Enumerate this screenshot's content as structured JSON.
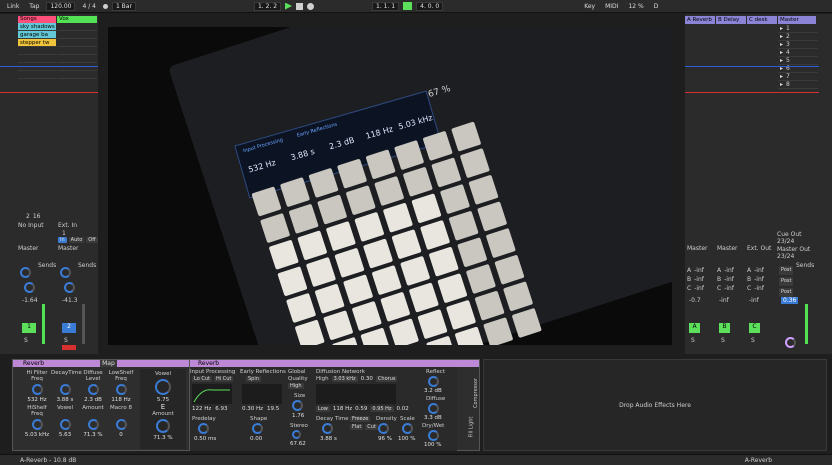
{
  "topbar": {
    "link": "Link",
    "tap": "Tap",
    "tempo": "120.00",
    "sig": "4 / 4",
    "metro": "1 Bar",
    "position": "1.  2.  2",
    "loop_start": "1.  1.  1",
    "loop_len": "4.  0.  0",
    "key": "Key",
    "midi": "MIDI",
    "cpu": "12 %",
    "disk": "D"
  },
  "tracks": {
    "headers": [
      "Songs",
      "Vox"
    ],
    "clips": [
      "sky shadows",
      "garage ba",
      "stepper tw"
    ],
    "input": {
      "none": "No Input",
      "ext": "Ext. In",
      "ch": "1"
    },
    "monitor": {
      "in": "In",
      "auto": "Auto",
      "off": "Off"
    },
    "routing": [
      "Master",
      "Master"
    ],
    "sends_label": "Sends",
    "volumes": [
      "-1.64",
      "-41.3"
    ],
    "numbers": [
      "1",
      "2"
    ],
    "solo": "S",
    "counts": [
      "2",
      "16"
    ]
  },
  "returns": {
    "headers": [
      "A Reverb",
      "B Delay",
      "C desk",
      "Master"
    ],
    "scenes": [
      "1",
      "2",
      "3",
      "4",
      "5",
      "6",
      "7",
      "8"
    ],
    "cue_out": "Cue Out",
    "cue_val": "23/24",
    "master_out": "Master Out",
    "master_val": "23/24",
    "routing": [
      "Master",
      "Master",
      "Ext. Out"
    ],
    "inf": "-inf",
    "post": "Post",
    "volumes": [
      "-0.7",
      "-inf",
      "-inf",
      "0.36"
    ],
    "letters": [
      "A",
      "B",
      "C"
    ],
    "solo": "S"
  },
  "video_text": {
    "screen": [
      "Input Processing",
      "Early Reflections",
      "532 Hz",
      "3.88 s",
      "2.3 dB",
      "118 Hz",
      "5.03 kHz",
      "67 %"
    ]
  },
  "device": {
    "title": "Reverb",
    "map": "Map",
    "macros": [
      {
        "label": "Hi Filter Freq",
        "value": "532 Hz"
      },
      {
        "label": "DecayTime",
        "value": "3.88 s"
      },
      {
        "label": "Diffuse Level",
        "value": "2.3 dB"
      },
      {
        "label": "LowShelf Freq",
        "value": "118 Hz"
      },
      {
        "label": "HiShelf Freq",
        "value": "5.03 kHz"
      },
      {
        "label": "Vowel",
        "value": "5.63"
      },
      {
        "label": "Amount",
        "value": "71.3 %"
      },
      {
        "label": "Macro 8",
        "value": "0"
      }
    ],
    "vowel_label": "Vowel",
    "vowel_value": "5.75",
    "vowel_letter": "E",
    "amount_label": "Amount",
    "amount_value": "71.3 %",
    "reverb_title": "Reverb",
    "input_processing": "Input Processing",
    "lo_cut": "Lo Cut",
    "hi_cut": "Hi Cut",
    "freq_vals": [
      "122 Hz",
      "6.93"
    ],
    "predelay": "Predelay",
    "predelay_val": "0.50 ms",
    "early": "Early Reflections",
    "spin": "Spin",
    "spin_vals": [
      "0.30 Hz",
      "19.5"
    ],
    "shape": "Shape",
    "shape_val": "0.00",
    "global": "Global",
    "quality": "Quality",
    "quality_val": "High",
    "size": "Size",
    "size_val": "1.76",
    "stereo": "Stereo",
    "stereo_val": "67.62",
    "diffusion": "Diffusion Network",
    "high": "High",
    "high_val": "3.03 kHz",
    "high_num": "0.30",
    "chorus": "Chorus",
    "low": "Low",
    "low_vals": [
      "118 Hz",
      "0.59"
    ],
    "chorus_vals": [
      "0.95 Hz",
      "0.02"
    ],
    "decay_time": "Decay Time",
    "decay_val": "3.88 s",
    "freeze": "Freeze",
    "flat": "Flat",
    "cut": "Cut",
    "density": "Density",
    "density_val": "96 %",
    "scale": "Scale",
    "scale_val": "100 %",
    "reflect": "Reflect",
    "reflect_val": "3.2 dB",
    "diffuse": "Diffuse",
    "diffuse_val": "3.3 dB",
    "drywet": "Dry/Wet",
    "drywet_val": "100 %",
    "side_labels": [
      "Compressor",
      "Fill Light"
    ]
  },
  "drop_text": "Drop Audio Effects Here",
  "status": {
    "left": "A-Reverb - 10.8 dB",
    "right": "A-Reverb"
  },
  "colors": {
    "accent": "#5ce05c",
    "device": "#bd88d6",
    "clip_cyan": "#62c8d6",
    "track_red": "#ff4f7b",
    "track_green": "#53e253"
  }
}
